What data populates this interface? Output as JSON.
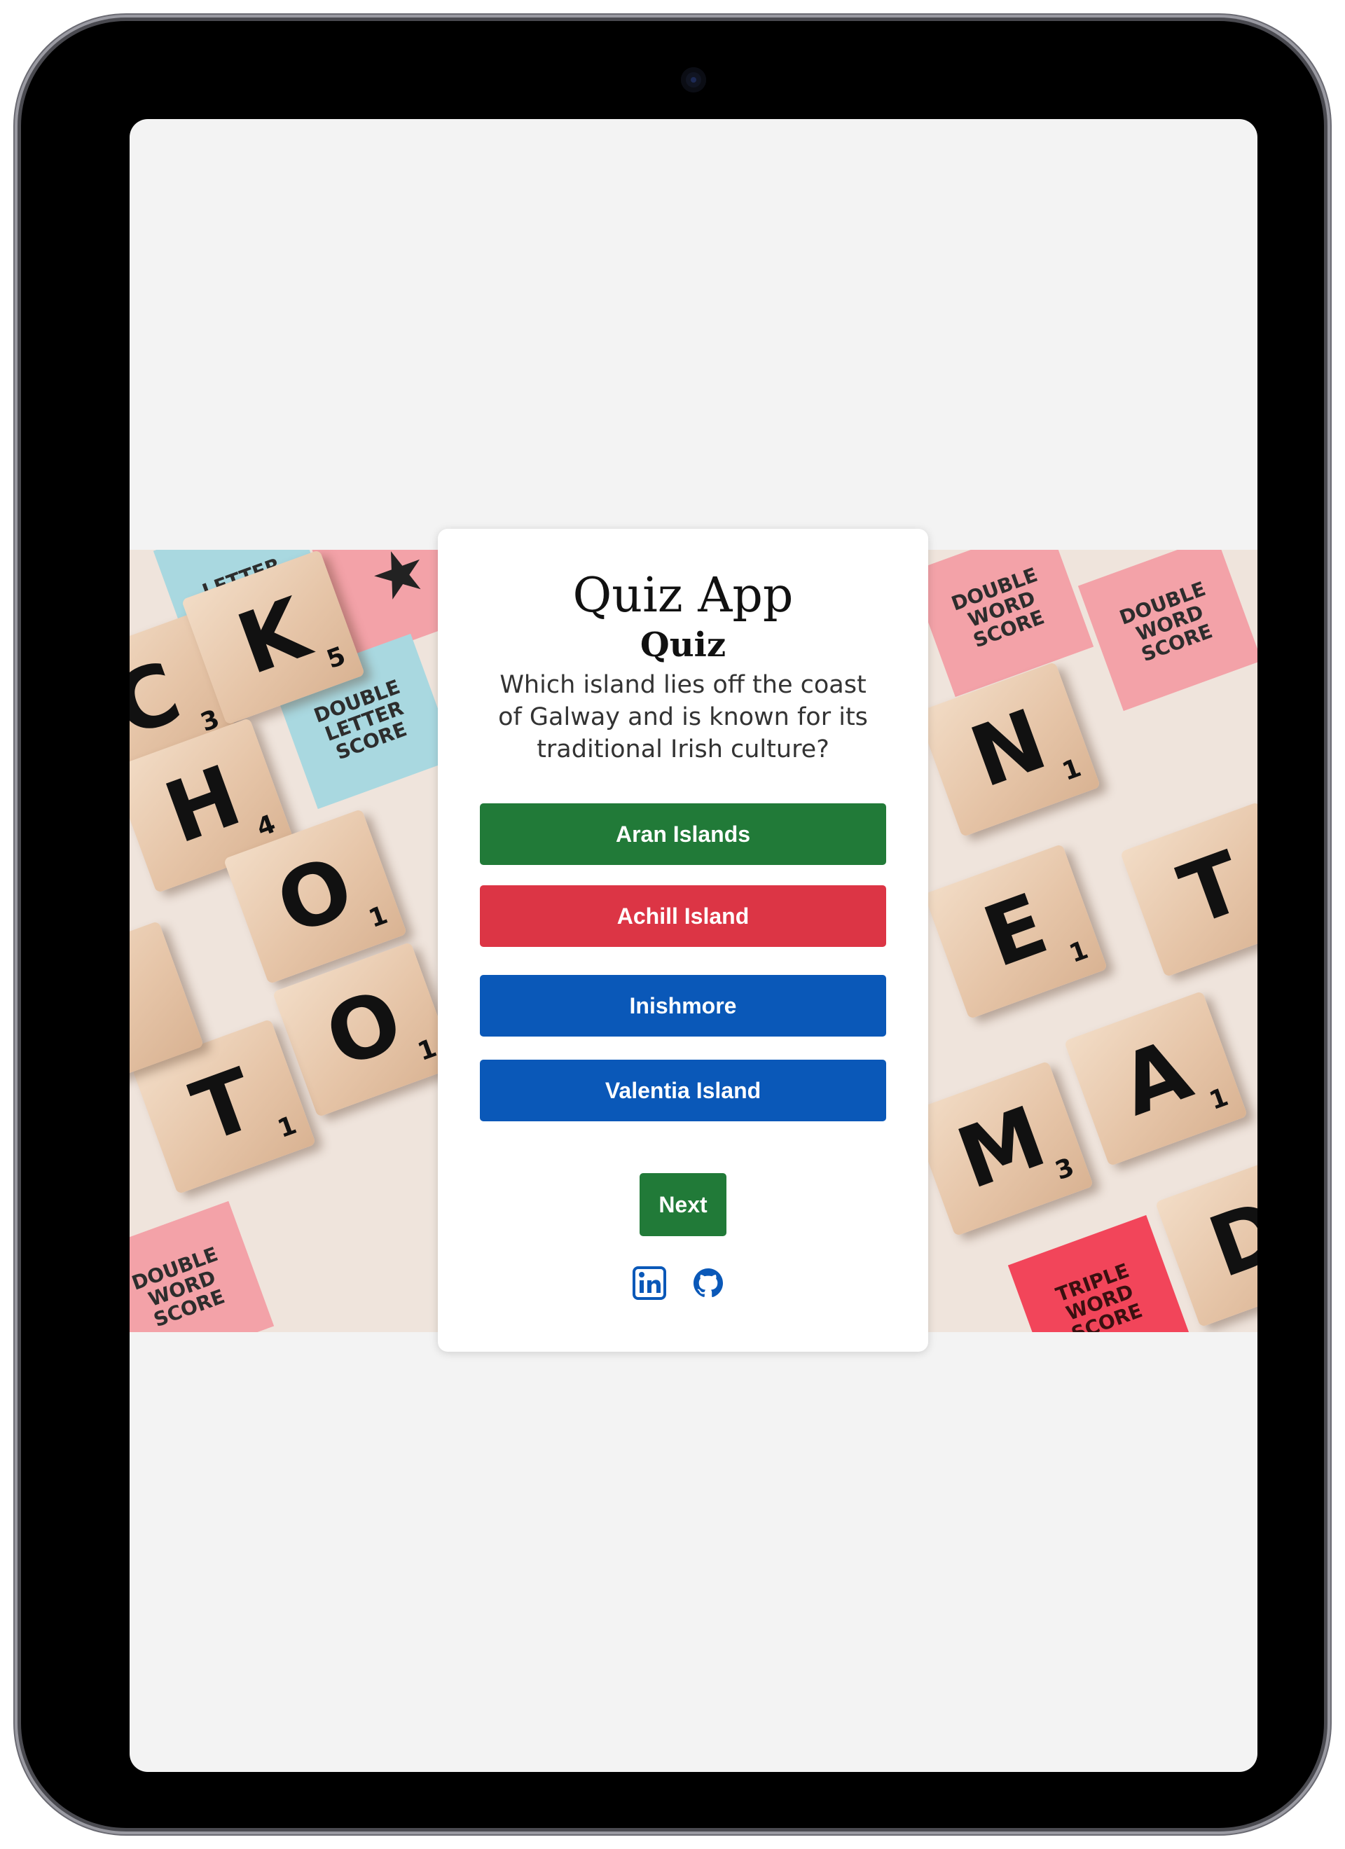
{
  "app": {
    "title": "Quiz App",
    "subtitle": "Quiz"
  },
  "question": {
    "text": "Which island lies off the coast of Galway and is known for its traditional Irish culture?"
  },
  "answers": [
    {
      "label": "Aran Islands",
      "color": "#217a38"
    },
    {
      "label": "Achill Island",
      "color": "#dc3545"
    },
    {
      "label": "Inishmore",
      "color": "#0a58b8"
    },
    {
      "label": "Valentia Island",
      "color": "#0a58b8"
    }
  ],
  "next": {
    "label": "Next",
    "color": "#217a38"
  },
  "footer": {
    "links": [
      {
        "icon": "linkedin-icon",
        "color": "#0a58b8"
      },
      {
        "icon": "github-icon",
        "color": "#0a58b8"
      }
    ]
  },
  "background": {
    "tiles": [
      {
        "letter": "K",
        "score": "5"
      },
      {
        "letter": "H",
        "score": "4"
      },
      {
        "letter": "O",
        "score": "1"
      },
      {
        "letter": "O",
        "score": "1"
      },
      {
        "letter": "T",
        "score": "1"
      },
      {
        "letter": "C",
        "score": "3"
      },
      {
        "letter": "N",
        "score": "1"
      },
      {
        "letter": "E",
        "score": "1"
      },
      {
        "letter": "A",
        "score": "1"
      },
      {
        "letter": "M",
        "score": "3"
      },
      {
        "letter": "T",
        "score": ""
      },
      {
        "letter": "D",
        "score": ""
      }
    ],
    "squares": [
      "DOUBLE LETTER SCORE",
      "DOUBLE WORD SCORE",
      "DOUBLE WORD SCORE",
      "DOUBLE WORD SCORE",
      "TRIPLE WORD SCORE",
      "LETTER SCORE"
    ]
  }
}
